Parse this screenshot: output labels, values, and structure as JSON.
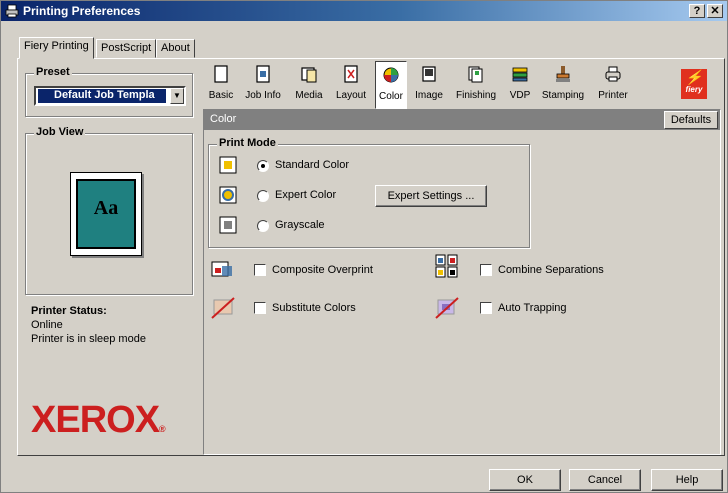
{
  "window": {
    "title": "Printing Preferences",
    "help_btn": "?",
    "close_btn": "✕"
  },
  "tabs": [
    "Fiery Printing",
    "PostScript",
    "About"
  ],
  "preset": {
    "label": "Preset",
    "value": "Default Job Templa"
  },
  "job_view": {
    "label": "Job View",
    "preview_text": "Aa"
  },
  "printer_status": {
    "label": "Printer Status:",
    "line1": "Online",
    "line2": "Printer is in sleep mode"
  },
  "brand": {
    "logo": "XEROX",
    "reg_mark": "®"
  },
  "toolbar": {
    "items": [
      {
        "label": "Basic",
        "icon": "page-icon"
      },
      {
        "label": "Job Info",
        "icon": "job-info-icon"
      },
      {
        "label": "Media",
        "icon": "media-icon"
      },
      {
        "label": "Layout",
        "icon": "layout-icon"
      },
      {
        "label": "Color",
        "icon": "color-icon"
      },
      {
        "label": "Image",
        "icon": "image-icon"
      },
      {
        "label": "Finishing",
        "icon": "finishing-icon"
      },
      {
        "label": "VDP",
        "icon": "vdp-icon"
      },
      {
        "label": "Stamping",
        "icon": "stamping-icon"
      },
      {
        "label": "Printer",
        "icon": "printer-icon"
      }
    ],
    "selected": "Color",
    "fiery_logo": "fiery"
  },
  "section": {
    "title": "Color",
    "defaults_label": "Defaults"
  },
  "print_mode": {
    "label": "Print Mode",
    "options": [
      {
        "label": "Standard Color",
        "checked": true
      },
      {
        "label": "Expert Color",
        "checked": false
      },
      {
        "label": "Grayscale",
        "checked": false
      }
    ],
    "expert_settings_label": "Expert Settings ..."
  },
  "options": {
    "composite_overprint": "Composite Overprint",
    "combine_separations": "Combine Separations",
    "substitute_colors": "Substitute Colors",
    "auto_trapping": "Auto Trapping"
  },
  "footer": {
    "ok": "OK",
    "cancel": "Cancel",
    "help": "Help"
  },
  "colors": {
    "title_bar": "#0a246a",
    "face": "#d4d0c8",
    "accent_red": "#cc1f1f",
    "preview_teal": "#1f8080"
  }
}
